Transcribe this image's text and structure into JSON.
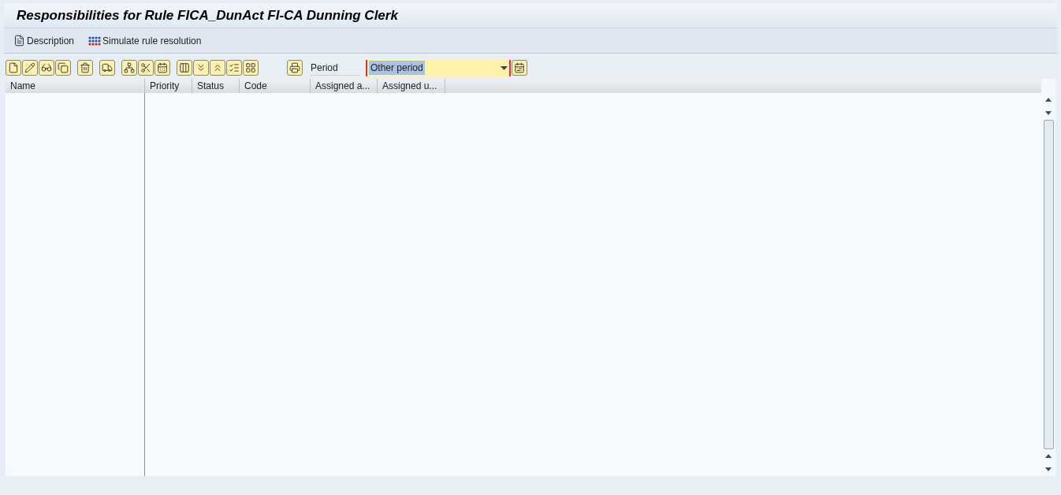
{
  "window": {
    "title": "Responsibilities for Rule FICA_DunAct FI-CA Dunning Clerk"
  },
  "app_toolbar": [
    {
      "label": "Description",
      "kind": "description"
    },
    {
      "label": "Simulate rule resolution",
      "kind": "simulate"
    }
  ],
  "period": {
    "label": "Period",
    "value": "Other period"
  },
  "tree": {
    "column": "Name"
  },
  "table": {
    "columns": [
      "Priority",
      "Status",
      "Code",
      "Assigned a...",
      "Assigned u..."
    ]
  }
}
